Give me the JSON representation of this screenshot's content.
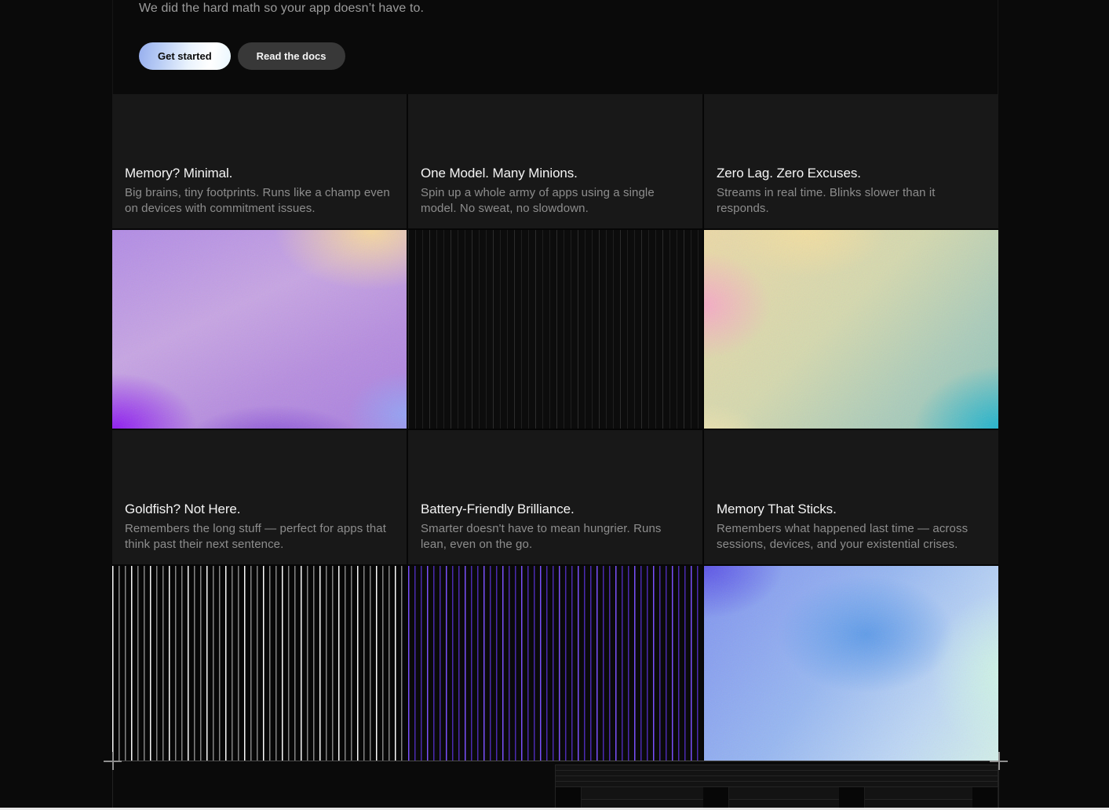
{
  "hero": {
    "subtitle": "We did the hard math so your app doesn’t have to.",
    "get_started_label": "Get started",
    "read_docs_label": "Read the docs"
  },
  "cards": [
    {
      "title": "Memory? Minimal.",
      "description": "Big brains, tiny footprints. Runs like a champ even on devices with commitment issues.",
      "media": "media-gradient-purple"
    },
    {
      "title": "One Model. Many Minions.",
      "description": "Spin up a whole army of apps using a single model. No sweat, no slowdown.",
      "media": "media-stripes-dark"
    },
    {
      "title": "Zero Lag. Zero Excuses.",
      "description": "Streams in real time. Blinks slower than it responds.",
      "media": "media-gradient-peach-teal"
    },
    {
      "title": "Goldfish? Not Here.",
      "description": "Remembers the long stuff — perfect for apps that think past their next sentence.",
      "media": "media-stripes-white"
    },
    {
      "title": "Battery-Friendly Brilliance.",
      "description": "Smarter doesn't have to mean hungrier. Runs lean, even on the go.",
      "media": "media-stripes-purple"
    },
    {
      "title": "Memory That Sticks.",
      "description": "Remembers what happened last time — across sessions, devices, and your existential crises.",
      "media": "media-gradient-blue"
    }
  ],
  "colors": {
    "page_bg": "#0a0a0a",
    "card_bg": "#181818",
    "title_text": "#f5f5f5",
    "body_text": "#8d8d8d",
    "secondary_button_bg": "#383838",
    "primary_button_gradient": [
      "#96aeee",
      "#ffffff"
    ],
    "gradient_purple": [
      "#8d18f2",
      "#c7a4e4",
      "#f8d99e",
      "#93a2f5"
    ],
    "gradient_peach_teal": [
      "#f6aac6",
      "#f3dfa0",
      "#cfd8ae",
      "#14b2cf"
    ],
    "gradient_blue": [
      "#5a52e8",
      "#96b7f3",
      "#cff5e6"
    ],
    "stripe_purple": "#5630cd",
    "stripe_white": "#ffffff"
  }
}
